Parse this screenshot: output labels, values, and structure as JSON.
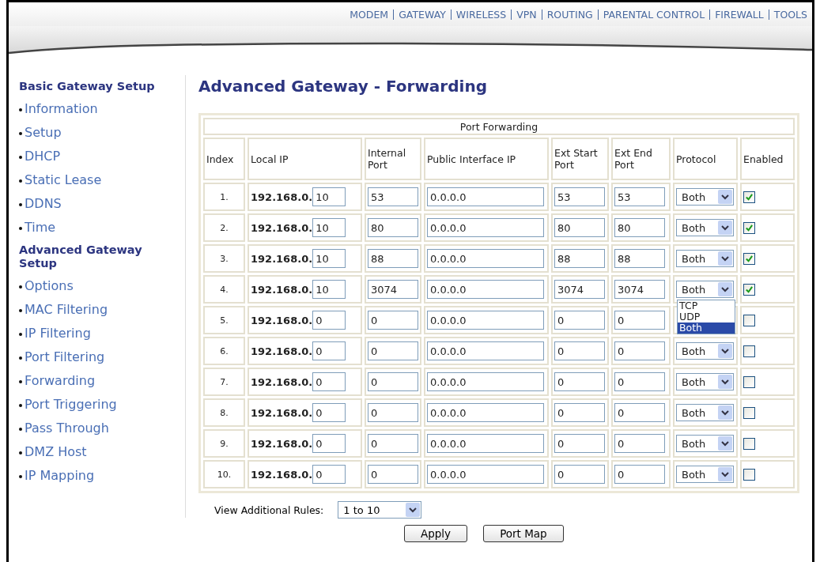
{
  "top_nav": [
    {
      "label": "MODEM"
    },
    {
      "label": "GATEWAY"
    },
    {
      "label": "WIRELESS"
    },
    {
      "label": "VPN"
    },
    {
      "label": "ROUTING"
    },
    {
      "label": "PARENTAL CONTROL"
    },
    {
      "label": "FIREWALL"
    },
    {
      "label": "TOOLS"
    }
  ],
  "sidebar": [
    {
      "heading": "Basic Gateway Setup",
      "items": [
        {
          "label": "Information"
        },
        {
          "label": "Setup"
        },
        {
          "label": "DHCP"
        },
        {
          "label": "Static Lease"
        },
        {
          "label": "DDNS"
        },
        {
          "label": "Time"
        }
      ]
    },
    {
      "heading": "Advanced Gateway Setup",
      "items": [
        {
          "label": "Options"
        },
        {
          "label": "MAC Filtering"
        },
        {
          "label": "IP Filtering"
        },
        {
          "label": "Port Filtering"
        },
        {
          "label": "Forwarding"
        },
        {
          "label": "Port Triggering"
        },
        {
          "label": "Pass Through"
        },
        {
          "label": "DMZ Host"
        },
        {
          "label": "IP Mapping"
        }
      ]
    }
  ],
  "page_title": "Advanced Gateway - Forwarding",
  "table": {
    "title": "Port Forwarding",
    "columns": [
      "Index",
      "Local IP",
      "Internal Port",
      "Public Interface IP",
      "Ext Start Port",
      "Ext End Port",
      "Protocol",
      "Enabled"
    ],
    "rows": [
      {
        "index": "1.",
        "ip_prefix": "192.168.0.",
        "ip_last": "10",
        "internal_port": "53",
        "public_ip": "0.0.0.0",
        "ext_start": "53",
        "ext_end": "53",
        "protocol": "Both",
        "enabled": true
      },
      {
        "index": "2.",
        "ip_prefix": "192.168.0.",
        "ip_last": "10",
        "internal_port": "80",
        "public_ip": "0.0.0.0",
        "ext_start": "80",
        "ext_end": "80",
        "protocol": "Both",
        "enabled": true
      },
      {
        "index": "3.",
        "ip_prefix": "192.168.0.",
        "ip_last": "10",
        "internal_port": "88",
        "public_ip": "0.0.0.0",
        "ext_start": "88",
        "ext_end": "88",
        "protocol": "Both",
        "enabled": true
      },
      {
        "index": "4.",
        "ip_prefix": "192.168.0.",
        "ip_last": "10",
        "internal_port": "3074",
        "public_ip": "0.0.0.0",
        "ext_start": "3074",
        "ext_end": "3074",
        "protocol": "Both",
        "enabled": true,
        "open_options": [
          {
            "label": "TCP",
            "selected": false
          },
          {
            "label": "UDP",
            "selected": false
          },
          {
            "label": "Both",
            "selected": true
          }
        ]
      },
      {
        "index": "5.",
        "ip_prefix": "192.168.0.",
        "ip_last": "0",
        "internal_port": "0",
        "public_ip": "0.0.0.0",
        "ext_start": "0",
        "ext_end": "0",
        "enabled": false
      },
      {
        "index": "6.",
        "ip_prefix": "192.168.0.",
        "ip_last": "0",
        "internal_port": "0",
        "public_ip": "0.0.0.0",
        "ext_start": "0",
        "ext_end": "0",
        "protocol": "Both",
        "enabled": false
      },
      {
        "index": "7.",
        "ip_prefix": "192.168.0.",
        "ip_last": "0",
        "internal_port": "0",
        "public_ip": "0.0.0.0",
        "ext_start": "0",
        "ext_end": "0",
        "protocol": "Both",
        "enabled": false
      },
      {
        "index": "8.",
        "ip_prefix": "192.168.0.",
        "ip_last": "0",
        "internal_port": "0",
        "public_ip": "0.0.0.0",
        "ext_start": "0",
        "ext_end": "0",
        "protocol": "Both",
        "enabled": false
      },
      {
        "index": "9.",
        "ip_prefix": "192.168.0.",
        "ip_last": "0",
        "internal_port": "0",
        "public_ip": "0.0.0.0",
        "ext_start": "0",
        "ext_end": "0",
        "protocol": "Both",
        "enabled": false
      },
      {
        "index": "10.",
        "ip_prefix": "192.168.0.",
        "ip_last": "0",
        "internal_port": "0",
        "public_ip": "0.0.0.0",
        "ext_start": "0",
        "ext_end": "0",
        "protocol": "Both",
        "enabled": false
      }
    ]
  },
  "view_rules": {
    "label": "View Additional Rules:",
    "value": "1 to 10"
  },
  "buttons": [
    {
      "label": "Apply"
    },
    {
      "label": "Port Map"
    }
  ]
}
